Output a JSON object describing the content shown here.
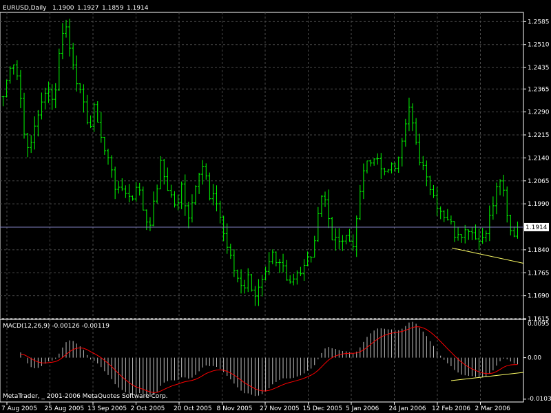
{
  "header": {
    "symbol": "EURUSD,Daily",
    "open": "1.1900",
    "high": "1.1927",
    "low": "1.1859",
    "close": "1.1914"
  },
  "footer": {
    "copyright": "MetaTrader, _ 2001-2006 MetaQuotes Software Corp."
  },
  "colors": {
    "background": "#000000",
    "grid": "#4a4a4a",
    "bars": "#00ff00",
    "price_line": "#8080c0",
    "trendline": "#ffff66",
    "signal": "#ff0000",
    "histogram": "#c0c0c0",
    "text": "#ffffff"
  },
  "chart_data": [
    {
      "type": "ohlc",
      "symbol": "EURUSD",
      "timeframe": "Daily",
      "current_price": "1.1914",
      "ylim": [
        1.1615,
        1.2615
      ],
      "yticks": [
        "1.2585",
        "1.2510",
        "1.2435",
        "1.2365",
        "1.2290",
        "1.2215",
        "1.2140",
        "1.2065",
        "1.1990",
        "1.1840",
        "1.1765",
        "1.1690",
        "1.1615"
      ],
      "xticks": [
        "7 Aug 2005",
        "25 Aug 2005",
        "13 Sep 2005",
        "2 Oct 2005",
        "20 Oct 2005",
        "8 Nov 2005",
        "27 Nov 2005",
        "15 Dec 2005",
        "5 Jan 2006",
        "24 Jan 2006",
        "12 Feb 2006",
        "2 Mar 2006"
      ],
      "close_path": [
        1.234,
        1.24,
        1.247,
        1.244,
        1.236,
        1.224,
        1.215,
        1.22,
        1.228,
        1.23,
        1.234,
        1.238,
        1.232,
        1.24,
        1.255,
        1.258,
        1.25,
        1.245,
        1.238,
        1.232,
        1.228,
        1.224,
        1.23,
        1.226,
        1.218,
        1.214,
        1.212,
        1.205,
        1.202,
        1.205,
        1.202,
        1.2,
        1.206,
        1.202,
        1.196,
        1.192,
        1.196,
        1.204,
        1.212,
        1.207,
        1.203,
        1.2,
        1.197,
        1.205,
        1.199,
        1.194,
        1.204,
        1.21,
        1.212,
        1.207,
        1.198,
        1.202,
        1.197,
        1.19,
        1.185,
        1.18,
        1.176,
        1.174,
        1.172,
        1.175,
        1.172,
        1.169,
        1.172,
        1.174,
        1.178,
        1.182,
        1.178,
        1.18,
        1.177,
        1.174,
        1.175,
        1.178,
        1.176,
        1.18,
        1.182,
        1.184,
        1.199,
        1.203,
        1.198,
        1.19,
        1.186,
        1.187,
        1.185,
        1.19,
        1.184,
        1.191,
        1.201,
        1.212,
        1.216,
        1.212,
        1.214,
        1.21,
        1.208,
        1.212,
        1.21,
        1.214,
        1.22,
        1.227,
        1.231,
        1.221,
        1.215,
        1.212,
        1.21,
        1.204,
        1.201,
        1.198,
        1.196,
        1.195,
        1.192,
        1.189,
        1.191,
        1.189,
        1.192,
        1.19,
        1.189,
        1.186,
        1.19,
        1.193,
        1.198,
        1.204,
        1.208,
        1.198,
        1.19,
        1.189,
        1.1914
      ],
      "trendline": [
        [
          0.62,
          1.1846
        ],
        [
          1.0,
          1.1796
        ]
      ]
    },
    {
      "type": "macd",
      "title": "MACD(12,26,9) -0.00126 -0.00119",
      "params": [
        12,
        26,
        9
      ],
      "main": "-0.00126",
      "signal": "-0.00119",
      "ylim": [
        -0.011,
        0.0095
      ],
      "yticks": [
        "0.0095",
        "0.00",
        "-0.0103"
      ]
    }
  ]
}
